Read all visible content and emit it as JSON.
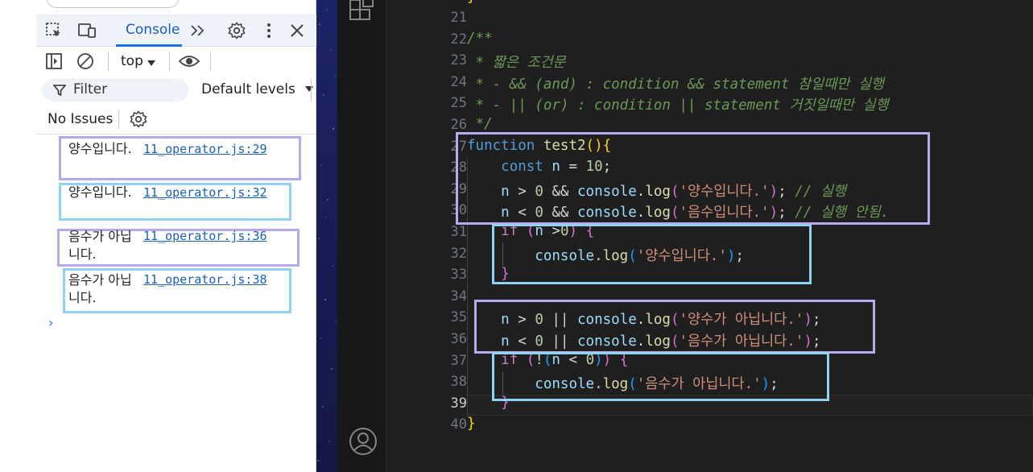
{
  "devtools": {
    "tab_console": "Console",
    "context": "top",
    "filter_placeholder": "Filter",
    "levels": "Default levels",
    "issues": "No Issues",
    "logs": [
      {
        "message": "양수입니다.",
        "source": "11_operator.js:29"
      },
      {
        "message": "양수입니다.",
        "source": "11_operator.js:32"
      },
      {
        "message": "음수가 아닙니다.",
        "source": "11_operator.js:36"
      },
      {
        "message": "음수가 아닙니다.",
        "source": "11_operator.js:38"
      }
    ],
    "prompt": "›"
  },
  "editor": {
    "line_numbers": [
      "21",
      "22",
      "23",
      "24",
      "25",
      "26",
      "27",
      "28",
      "29",
      "30",
      "31",
      "32",
      "33",
      "34",
      "35",
      "36",
      "37",
      "38",
      "39",
      "40"
    ],
    "active_line": "39",
    "top_line_fragment": "}",
    "code": {
      "l22": "/**",
      "l23": " * 짧은 조건문",
      "l24": " * - && (and) : condition && statement 참일때만 실행",
      "l25": " * - || (or) : condition || statement 거짓일때만 실행",
      "l26": " */",
      "l27_kw": "function",
      "l27_name": "test2",
      "l28_kw": "const",
      "l28_var": "n",
      "l28_val": "10",
      "l29_str": "'양수입니다.'",
      "l29_comment": "// 실행",
      "l30_str": "'음수입니다.'",
      "l30_comment": "// 실행 안됨.",
      "l31_if": "if",
      "l32_str": "'양수입니다.'",
      "l35_str": "'양수가 아닙니다.'",
      "l36_str": "'음수가 아닙니다.'",
      "l38_str": "'음수가 아닙니다.'",
      "console": "console",
      "log": "log",
      "n": "n",
      "zero": "0"
    }
  },
  "colors": {
    "box_purple": "#b8a9ec",
    "box_blue": "#8fd3f0",
    "editor_bg": "#1f1f1f",
    "link": "#1a5fb4"
  }
}
